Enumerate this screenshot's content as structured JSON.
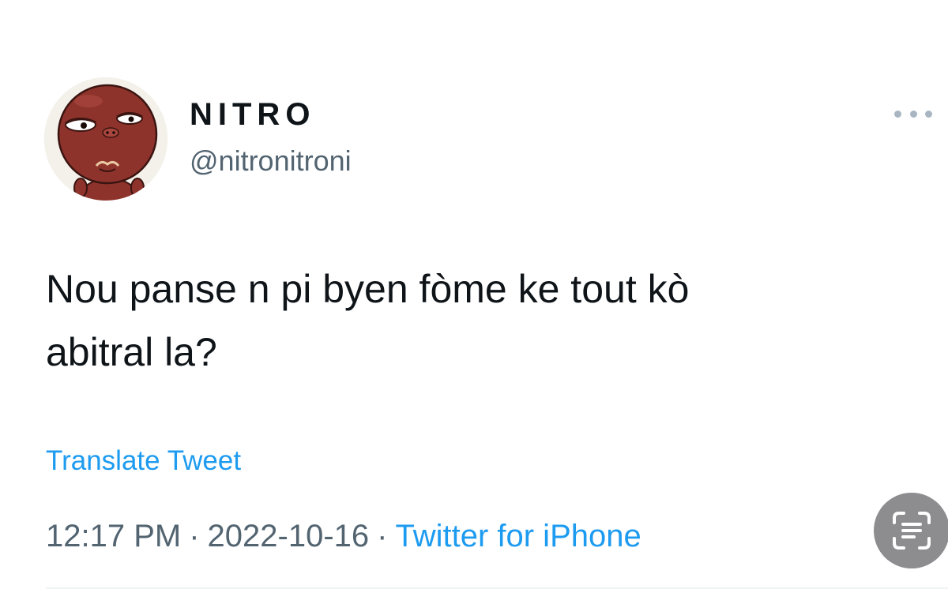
{
  "tweet": {
    "author": {
      "display_name": "NITRO",
      "handle": "@nitronitroni"
    },
    "text_line1": "Nou panse n pi byen fòme ke tout kò",
    "text_line2": "abitral la?",
    "translate_label": "Translate Tweet",
    "time": "12:17 PM",
    "date": "2022-10-16",
    "separator": "·",
    "source": "Twitter for iPhone"
  },
  "icons": {
    "more": "more-horizontal-icon",
    "scan": "live-text-scan-icon",
    "avatar": "cartoon-character-avatar"
  },
  "colors": {
    "link": "#1d9bf0",
    "secondary_text": "#536471",
    "primary_text": "#0f1419",
    "avatar_face": "#8e332c",
    "scan_button": "#8d8d90"
  }
}
